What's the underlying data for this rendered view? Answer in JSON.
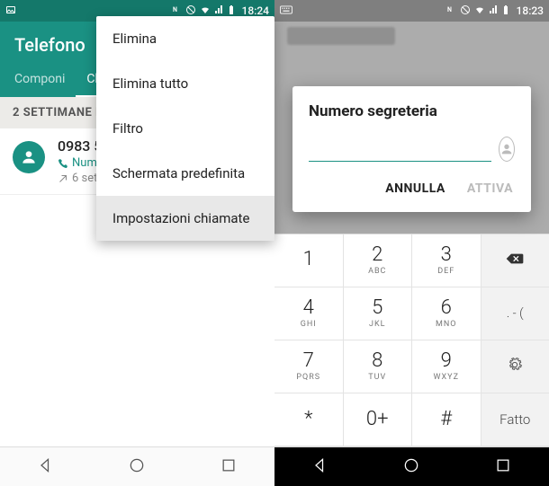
{
  "left": {
    "statusbar": {
      "time": "18:24"
    },
    "header": {
      "title": "Telefono"
    },
    "tabs": {
      "compose": "Componi",
      "log": "Ch"
    },
    "section": "2 SETTIMANE F",
    "call": {
      "number": "0983 5",
      "label": "Num",
      "date": "6 set"
    },
    "menu": {
      "items": [
        "Elimina",
        "Elimina tutto",
        "Filtro",
        "Schermata predefinita",
        "Impostazioni chiamate"
      ]
    }
  },
  "right": {
    "statusbar": {
      "time": "18:23"
    },
    "dialog": {
      "title": "Numero segreteria",
      "value": "",
      "cancel": "ANNULLA",
      "confirm": "ATTIVA"
    },
    "keypad": {
      "rows": [
        [
          {
            "d": "1",
            "l": ""
          },
          {
            "d": "2",
            "l": "ABC"
          },
          {
            "d": "3",
            "l": "DEF"
          },
          {
            "icon": "backspace"
          }
        ],
        [
          {
            "d": "4",
            "l": "GHI"
          },
          {
            "d": "5",
            "l": "JKL"
          },
          {
            "d": "6",
            "l": "MNO"
          },
          {
            "d": ". - (",
            "l": ""
          }
        ],
        [
          {
            "d": "7",
            "l": "PQRS"
          },
          {
            "d": "8",
            "l": "TUV"
          },
          {
            "d": "9",
            "l": "WXYZ"
          },
          {
            "icon": "gear"
          }
        ],
        [
          {
            "d": "*",
            "l": ""
          },
          {
            "d": "0+",
            "l": ""
          },
          {
            "d": "#",
            "l": ""
          },
          {
            "d": "Fatto",
            "l": ""
          }
        ]
      ]
    }
  }
}
